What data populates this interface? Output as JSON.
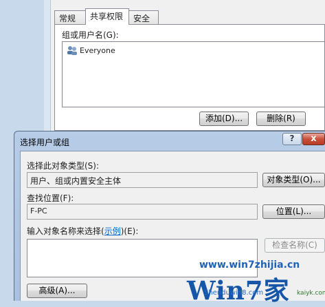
{
  "back_dialog": {
    "tabs": [
      "常规",
      "共享权限",
      "安全"
    ],
    "group_label": "组或用户名(G):",
    "users": [
      "Everyone"
    ],
    "add_button": "添加(D)...",
    "remove_button": "删除(R)"
  },
  "front_dialog": {
    "title": "选择用户或组",
    "help": "?",
    "close": "x",
    "object_type_label": "选择此对象类型(S):",
    "object_type_value": "用户、组或内置安全主体",
    "object_type_button": "对象类型(O)...",
    "location_label": "查找位置(F):",
    "location_value": "F-PC",
    "location_button": "位置(L)...",
    "enter_label_prefix": "输入对象名称来选择(",
    "enter_label_link": "示例",
    "enter_label_suffix": ")(E):",
    "check_names_button": "检查名称(C)",
    "advanced_button": "高级(A)..."
  },
  "watermark": {
    "site1": "www.win7zhijia.cn",
    "logo": "Win7家",
    "site2": "Shenduwin8.com",
    "site3": "kaiyk.com"
  }
}
